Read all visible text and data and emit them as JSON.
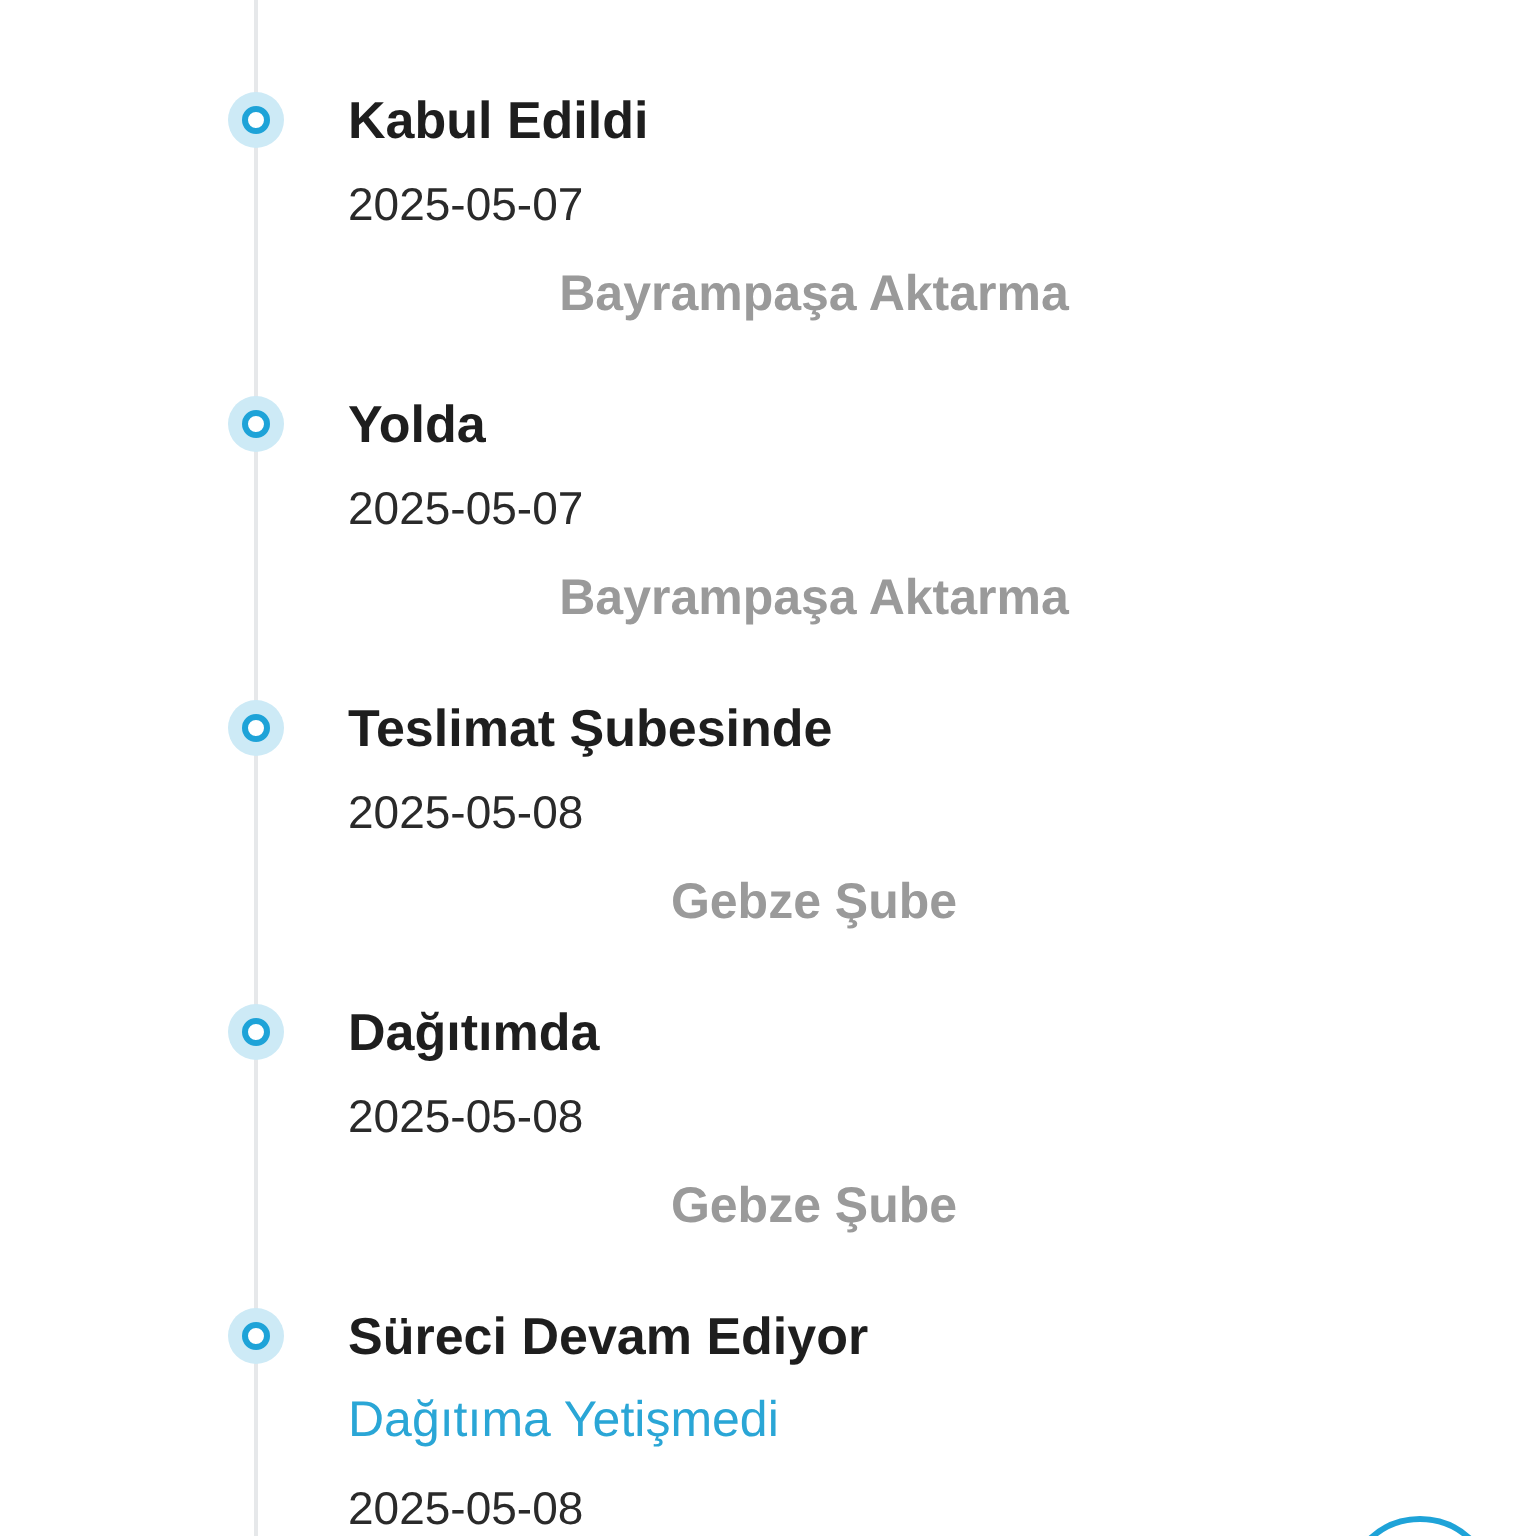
{
  "events": [
    {
      "status": "Kabul Edildi",
      "date": "2025-05-07",
      "location": "Bayrampaşa Aktarma"
    },
    {
      "status": "Yolda",
      "date": "2025-05-07",
      "location": "Bayrampaşa Aktarma"
    },
    {
      "status": "Teslimat Şubesinde",
      "date": "2025-05-08",
      "location": "Gebze Şube"
    },
    {
      "status": "Dağıtımda",
      "date": "2025-05-08",
      "location": "Gebze Şube"
    },
    {
      "status": "Süreci Devam Ediyor",
      "note": "Dağıtıma Yetişmedi",
      "date": "2025-05-08"
    }
  ]
}
